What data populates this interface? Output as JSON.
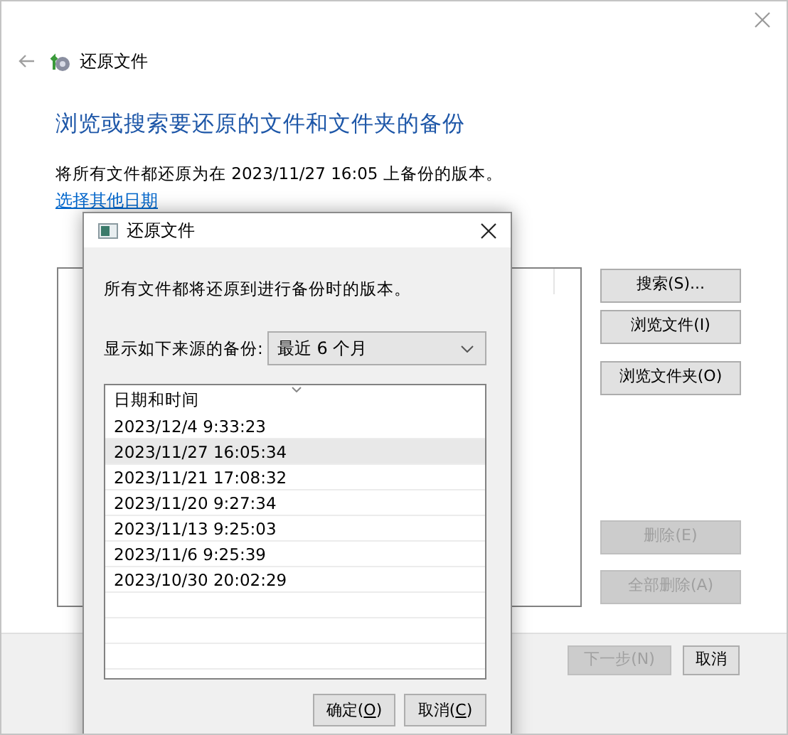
{
  "window": {
    "title": "还原文件"
  },
  "heading": "浏览或搜索要还原的文件和文件夹的备份",
  "description": "将所有文件都还原为在 2023/11/27 16:05 上备份的版本。",
  "change_date_link": "选择其他日期",
  "side_buttons_top": [
    {
      "label": "搜索(S)...",
      "disabled": false
    },
    {
      "label": "浏览文件(I)",
      "disabled": false
    },
    {
      "label": "浏览文件夹(O)",
      "disabled": false
    }
  ],
  "side_buttons_bottom": [
    {
      "label": "删除(E)",
      "disabled": true
    },
    {
      "label": "全部删除(A)",
      "disabled": true
    }
  ],
  "footer_buttons": [
    {
      "label": "下一步(N)",
      "disabled": true
    },
    {
      "label": "取消",
      "disabled": false
    }
  ],
  "dialog": {
    "title": "还原文件",
    "message": "所有文件都将还原到进行备份时的版本。",
    "source_label": "显示如下来源的备份:",
    "source_value": "最近 6 个月",
    "column": "日期和时间",
    "rows": [
      {
        "text": "2023/12/4 9:33:23",
        "selected": false
      },
      {
        "text": "2023/11/27 16:05:34",
        "selected": true
      },
      {
        "text": "2023/11/21 17:08:32",
        "selected": false
      },
      {
        "text": "2023/11/20 9:27:34",
        "selected": false
      },
      {
        "text": "2023/11/13 9:25:03",
        "selected": false
      },
      {
        "text": "2023/11/6 9:25:39",
        "selected": false
      },
      {
        "text": "2023/10/30 20:02:29",
        "selected": false
      }
    ],
    "buttons": [
      {
        "label_parts": [
          "确定(",
          "O",
          ")"
        ]
      },
      {
        "label_parts": [
          "取消(",
          "C",
          ")"
        ]
      }
    ]
  }
}
